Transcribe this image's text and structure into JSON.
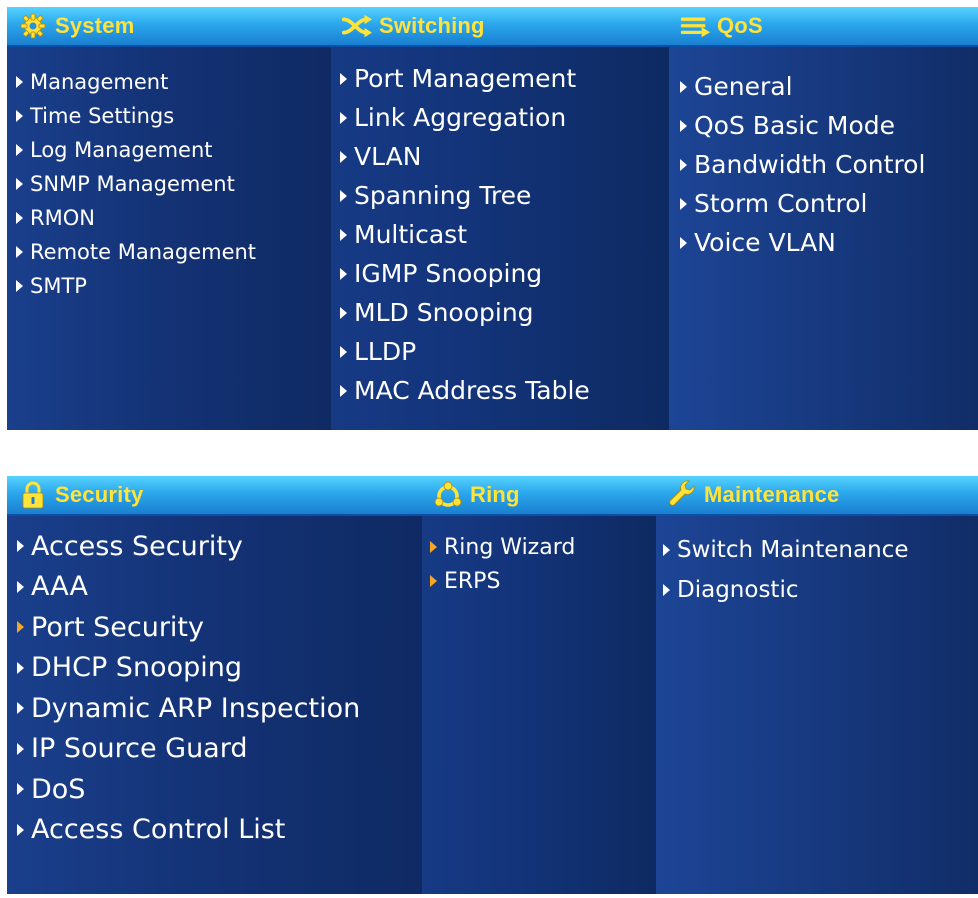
{
  "panels": {
    "top": {
      "system": {
        "title": "System",
        "icon": "gear-icon",
        "items": [
          "Management",
          "Time Settings",
          "Log Management",
          "SNMP Management",
          "RMON",
          "Remote Management",
          "SMTP"
        ]
      },
      "switching": {
        "title": "Switching",
        "icon": "crossed-arrows-icon",
        "items": [
          "Port Management",
          "Link Aggregation",
          "VLAN",
          "Spanning Tree",
          "Multicast",
          "IGMP Snooping",
          "MLD Snooping",
          "LLDP",
          "MAC Address Table"
        ]
      },
      "qos": {
        "title": "QoS",
        "icon": "qos-lines-icon",
        "items": [
          "General",
          "QoS Basic Mode",
          "Bandwidth Control",
          "Storm Control",
          "Voice VLAN"
        ]
      }
    },
    "bottom": {
      "security": {
        "title": "Security",
        "icon": "lock-icon",
        "items": [
          "Access Security",
          "AAA",
          "Port Security",
          "DHCP Snooping",
          "Dynamic ARP Inspection",
          "IP Source Guard",
          "DoS",
          "Access Control List"
        ],
        "active_item": "Port Security"
      },
      "ring": {
        "title": "Ring",
        "icon": "ring-icon",
        "items": [
          "Ring Wizard",
          "ERPS"
        ]
      },
      "maintenance": {
        "title": "Maintenance",
        "icon": "wrench-icon",
        "items": [
          "Switch Maintenance",
          "Diagnostic"
        ]
      }
    }
  },
  "colors": {
    "header_title": "#ffe23a",
    "menu_text": "#ffffff",
    "highlight_arrow": "#f5a623",
    "header_gradient_top": "#56d3ff",
    "panel_background": "#143377"
  }
}
